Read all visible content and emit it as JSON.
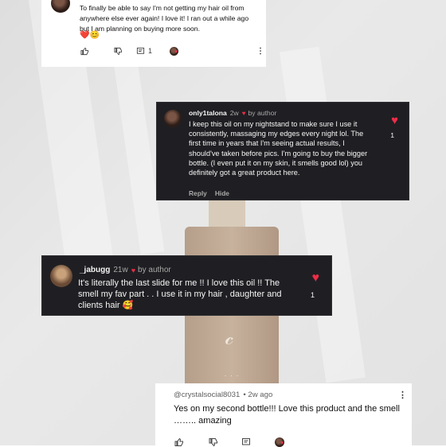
{
  "yt_top": {
    "text": "To finally be able to say I'm not getting my hair oil from anywhere else ever again! I love it! I ran out a while ago but I am planning on buying more soon.",
    "emoji": "❤️😊",
    "reply_count": "1"
  },
  "ig_1": {
    "username": "only1talona",
    "age": "2w",
    "liked_by": "by author",
    "text": "I keep this oil on my nightstand to make sure I use it consistently, massaging my edges every night lol. The first time in years that I'm seeing actual results, I should've taken before pics. I'm going to buy the bigger bottle. (I even put it on my skin, it smells good lol) you definitely got a great product here.",
    "like_count": "1",
    "reply_label": "Reply",
    "hide_label": "Hide"
  },
  "ig_2": {
    "username": "_jabugg",
    "age": "21w",
    "liked_by": "by author",
    "text": "It's literally the last slide for me !! I love this oil !! The smell my fav part . . I use it in my hair , daughter and clients hair 🥰",
    "like_count": "1"
  },
  "yt_bottom": {
    "username": "@crystalsocial8031",
    "age": "• 2w ago",
    "text": "Yes on my second bottle!!! Love this product and the smell …….. amazing"
  },
  "colors": {
    "heart": "#ed2d48",
    "ig_bg": "#1f1f23"
  },
  "icons": [
    "thumbs-up-icon",
    "thumbs-down-icon",
    "reply-icon",
    "more-vertical-icon",
    "heart-icon"
  ]
}
